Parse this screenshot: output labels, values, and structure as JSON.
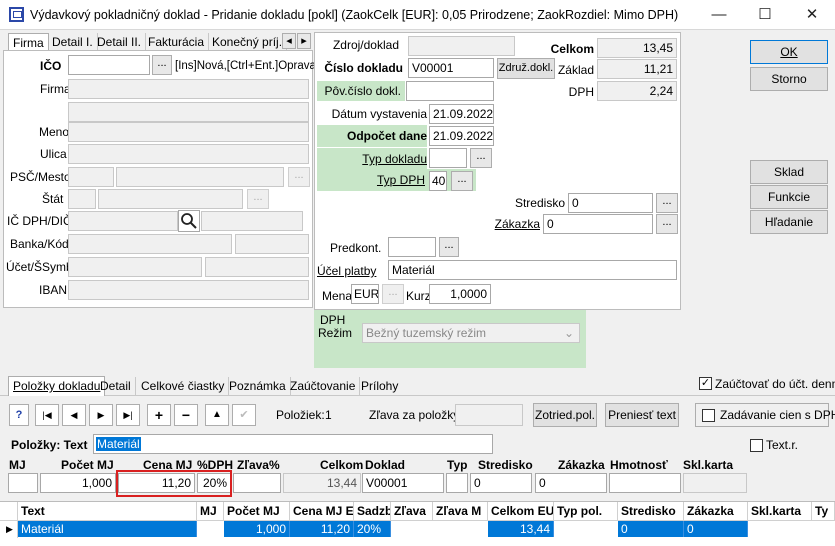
{
  "window": {
    "title": "Výdavkový pokladničný doklad - Pridanie dokladu  [pokl]  (ZaokCelk [EUR]: 0,05 Prirodzene; ZaokRozdiel: Mimo DPH)",
    "minimize": "—",
    "maximize": "☐",
    "close": "✕"
  },
  "left_tabs": [
    "Firma",
    "Detail I.",
    "Detail II.",
    "Fakturácia",
    "Konečný príj."
  ],
  "firma": {
    "ico_label": "IČO",
    "ico_hint": "[Ins]Nová,[Ctrl+Ent.]Oprava",
    "firma_label": "Firma",
    "meno_label": "Meno",
    "ulica_label": "Ulica",
    "psc_label": "PSČ/Mesto",
    "stat_label": "Štát",
    "icdph_label": "IČ DPH/DIČ",
    "banka_label": "Banka/Kód",
    "ucet_label": "Účet/ŠSymb",
    "iban_label": "IBAN"
  },
  "doc": {
    "zdroj_label": "Zdroj/doklad",
    "cislo_label": "Číslo dokladu",
    "cislo_value": "V00001",
    "zdruz_button": "Združ.dokl.",
    "pov_label": "Pôv.číslo dokl.",
    "datum_label": "Dátum vystavenia",
    "datum_value": "21.09.2022",
    "odpocet_label": "Odpočet dane",
    "odpocet_value": "21.09.2022",
    "typ_label": "Typ dokladu",
    "typdph_label": "Typ DPH",
    "typdph_value": "40",
    "stredisko_label": "Stredisko",
    "stredisko_value": "0",
    "zakazka_label": "Zákazka",
    "zakazka_value": "0",
    "predkont_label": "Predkont.",
    "ucel_label": "Účel platby",
    "ucel_value": "Materiál",
    "mena_label": "Mena",
    "mena_value": "EUR",
    "kurz_label": "Kurz",
    "kurz_value": "1,0000",
    "celkom_label": "Celkom",
    "celkom_value": "13,45",
    "zaklad_label": "Základ",
    "zaklad_value": "11,21",
    "dph_label": "DPH",
    "dph_value": "2,24"
  },
  "dph_box": {
    "title": "DPH",
    "rezim_label": "Režim",
    "rezim_value": "Bežný tuzemský režim"
  },
  "right_buttons": {
    "ok": "OK",
    "storno": "Storno",
    "sklad": "Sklad",
    "funkcie": "Funkcie",
    "hladanie": "Hľadanie"
  },
  "bottom_tabs": [
    "Položky dokladu",
    "Detail",
    "Celkové čiastky",
    "Poznámka",
    "Zaúčtovanie",
    "Prílohy"
  ],
  "zauctovat_label": "Zaúčtovať do účt. denní",
  "toolbar": {
    "help": "?",
    "first": "|◀",
    "prev": "◀",
    "next": "▶",
    "last": "▶|",
    "add": "+",
    "remove": "−",
    "up": "▲",
    "check": "✔",
    "poloziek_label": "Položiek:",
    "poloziek_value": "1",
    "zlava_label": "Zľava za položky",
    "zotried_button": "Zotried.pol.",
    "preniest_button": "Preniesť text",
    "zadavanie_label": "Zadávanie cien s DPH"
  },
  "polozky": {
    "label": "Položky: Text",
    "text_value": "Materiál",
    "textr_label": "Text.r."
  },
  "edit_headers": [
    "MJ",
    "Počet MJ",
    "Cena MJ",
    "%DPH",
    "Zľava%",
    "Celkom",
    "Doklad",
    "Typ",
    "Stredisko",
    "Zákazka",
    "Hmotnosť",
    "Skl.karta"
  ],
  "edit_row": {
    "mj": "",
    "pocet": "1,000",
    "cena": "11,20",
    "dph": "20%",
    "zlava": "",
    "celkom": "13,44",
    "doklad": "V00001",
    "typ": "",
    "stredisko": "0",
    "zakazka": "0",
    "hmotnost": "",
    "sklkarta": ""
  },
  "grid_headers": [
    "Text",
    "MJ",
    "Počet MJ",
    "Cena MJ E",
    "Sadzb",
    "Zľava",
    "Zľava M",
    "Celkom EU",
    "Typ pol.",
    "Stredisko",
    "Zákazka",
    "Skl.karta",
    "Ty"
  ],
  "grid_row": [
    "Materiál",
    "",
    "1,000",
    "11,20",
    "20%",
    "",
    "",
    "13,44",
    "",
    "0",
    "0",
    "",
    ""
  ],
  "colors": {
    "highlight": "#0078d7",
    "green_label": "#c8e6c8",
    "red_box": "#d92020"
  }
}
